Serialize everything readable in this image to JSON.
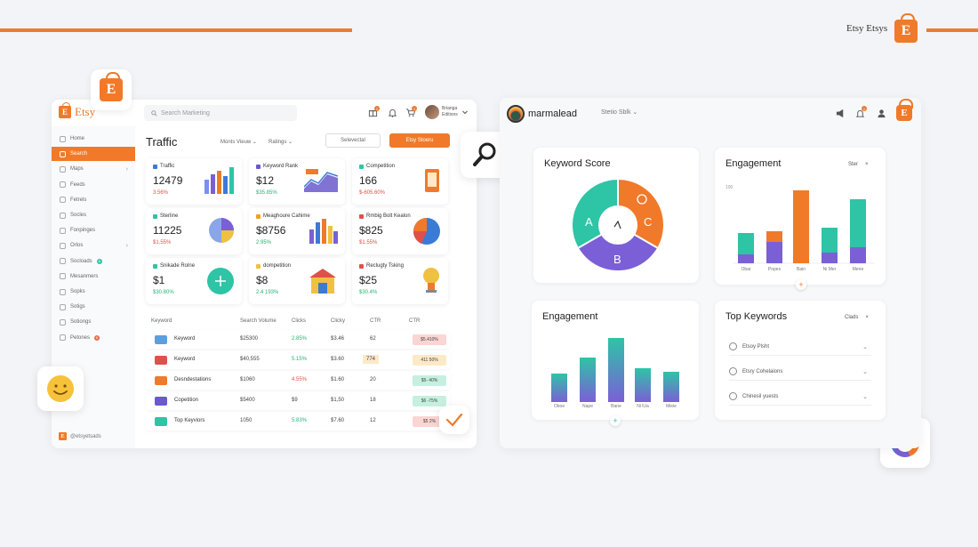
{
  "brand": {
    "top_text": "Etsy Etsys",
    "bag_letter": "E"
  },
  "left_panel": {
    "logo_text": "Etsy",
    "search_placeholder": "Search Marketing",
    "notif_badge_1": "1",
    "notif_badge_2": "1",
    "user_name_1": "Brianga",
    "user_name_2": "Editions",
    "sidebar": [
      {
        "label": "Home"
      },
      {
        "label": "Search",
        "active": true
      },
      {
        "label": "Maps"
      },
      {
        "label": "Feeds"
      },
      {
        "label": "Fetrels"
      },
      {
        "label": "Socles"
      },
      {
        "label": "Fonpinges"
      },
      {
        "label": "Orlos"
      },
      {
        "label": "Socloads",
        "badge": "8"
      },
      {
        "label": "Mesanmers"
      },
      {
        "label": "Sopks"
      },
      {
        "label": "Sotigs"
      },
      {
        "label": "Sotiongs"
      },
      {
        "label": "Petones",
        "badge": "6"
      }
    ],
    "page_title": "Traffic",
    "filter_1": "Monts Vieuw",
    "filter_2": "Ratings",
    "btn_outline": "Selevectal",
    "btn_primary": "Etsy Stoeru",
    "cards": [
      {
        "title": "Traffic",
        "value": "12479",
        "sub": "3.56%",
        "sub_color": "#e0504a",
        "icon_color": "#3a7bd5"
      },
      {
        "title": "Keyword Rank",
        "value": "$12",
        "sub": "$35.85%",
        "sub_color": "#22b573",
        "icon_color": "#6a5acd"
      },
      {
        "title": "Competition",
        "value": "166",
        "sub": "$-605.60%",
        "sub_color": "#e0504a",
        "icon_color": "#2ec4a6"
      },
      {
        "title": "Sterline",
        "value": "11225",
        "sub": "$1.55%",
        "sub_color": "#e0504a",
        "icon_color": "#2ec4a6"
      },
      {
        "title": "Meaghoure Cahime",
        "value": "$8756",
        "sub": "2.95%",
        "sub_color": "#22b573",
        "icon_color": "#f0a020"
      },
      {
        "title": "Rmbig Bolt Kealon",
        "value": "$825",
        "sub": "$1.55%",
        "sub_color": "#e0504a",
        "icon_color": "#e0504a"
      },
      {
        "title": "Snikade Rolne",
        "value": "$1",
        "sub": "$30.80%",
        "sub_color": "#22b573",
        "icon_color": "#2ec4a6"
      },
      {
        "title": "dompetition",
        "value": "$8",
        "sub": "2.4 193%",
        "sub_color": "#22b573",
        "icon_color": "#f0c040"
      },
      {
        "title": "Reclugty Tsking",
        "value": "$25",
        "sub": "$30.4%",
        "sub_color": "#22b573",
        "icon_color": "#e0504a"
      }
    ],
    "table": {
      "headers": [
        "Keyword",
        "Search Volume",
        "Clicks",
        "Clicky",
        "CTR",
        "CTR"
      ],
      "rows": [
        {
          "keyword": "Keyword",
          "volume": "$25300",
          "clicks": "2.85%",
          "clicks_color": "#22b573",
          "clicky": "$3.46",
          "ctr": "62",
          "ctr2": "$5.410%",
          "ctr2_bg": "#fbd5d2",
          "thumb": "#5aa0e0"
        },
        {
          "keyword": "Keyword",
          "volume": "$40,555",
          "clicks": "5.15%",
          "clicks_color": "#22b573",
          "clicky": "$3.60",
          "ctr": "774",
          "ctr_bg": "#fde9c6",
          "ctr2": "411 50%",
          "ctr2_bg": "#fde9c6",
          "thumb": "#e0504a"
        },
        {
          "keyword": "Desndestations",
          "volume": "$1060",
          "clicks": "4.55%",
          "clicks_color": "#e0504a",
          "clicky": "$1.60",
          "ctr": "20",
          "ctr2": "$5- 40%",
          "ctr2_bg": "#c5f0df",
          "thumb": "#f07a2a"
        },
        {
          "keyword": "Copetition",
          "volume": "$5400",
          "clicks": "$9",
          "clicks_color": "#444",
          "clicky": "$1,50",
          "ctr": "18",
          "ctr2": "$6 -75%",
          "ctr2_bg": "#c5f0df",
          "thumb": "#6a5acd"
        },
        {
          "keyword": "Top Keyviors",
          "volume": "1050",
          "clicks": "5.83%",
          "clicks_color": "#22b573",
          "clicky": "$7.60",
          "ctr": "12",
          "ctr2": "$5 2%",
          "ctr2_bg": "#fbd5d2",
          "thumb": "#2ec4a6"
        }
      ]
    },
    "footer": "@etsyetsads"
  },
  "right_panel": {
    "logo_text": "marmalead",
    "search_text": "Stetio Sblk",
    "notif_badge": "1",
    "keyword_score": {
      "title": "Keyword Score",
      "segments": [
        {
          "label": "A",
          "color": "#2ec4a6"
        },
        {
          "label": "C",
          "color": "#f07a2a"
        },
        {
          "label": "B",
          "color": "#7b5fd6"
        }
      ]
    },
    "engagement_top": {
      "title": "Engagement",
      "chip": "Ster",
      "close": "×",
      "y_top": "100",
      "cats": [
        "Obar",
        "Popes",
        "Bain",
        "Ni Mer",
        "Mene"
      ]
    },
    "engagement_bottom": {
      "title": "Engagement",
      "cats": [
        "Oboe",
        "Nape",
        "Bane",
        "Ni lUa",
        "Mieie"
      ]
    },
    "top_keywords": {
      "title": "Top Keywords",
      "chip": "Clads",
      "close": "×",
      "items": [
        "Etsoy Plsht",
        "Etsry Cohelaions",
        "Chinesil yuests"
      ]
    }
  }
}
